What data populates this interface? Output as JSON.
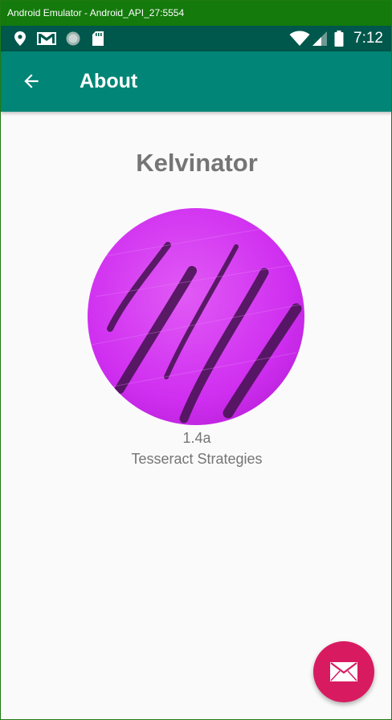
{
  "emulator": {
    "title": "Android Emulator - Android_API_27:5554"
  },
  "status_bar": {
    "time": "7:12",
    "icons": [
      "location-icon",
      "gmail-icon",
      "sync-circle-icon",
      "sd-card-icon",
      "wifi-icon",
      "signal-icon",
      "battery-icon"
    ]
  },
  "app_bar": {
    "back_icon": "arrow-back-icon",
    "title": "About"
  },
  "about": {
    "app_name": "Kelvinator",
    "logo": "kelvinator-logo",
    "version": "1.4a",
    "company": "Tesseract Strategies"
  },
  "fab": {
    "icon": "email-icon",
    "color": "#d81b60"
  },
  "colors": {
    "titlebar": "#137a0b",
    "status_bar": "#00574b",
    "app_bar": "#008577",
    "logo_purple": "#d43bef",
    "text_gray": "#757575"
  }
}
